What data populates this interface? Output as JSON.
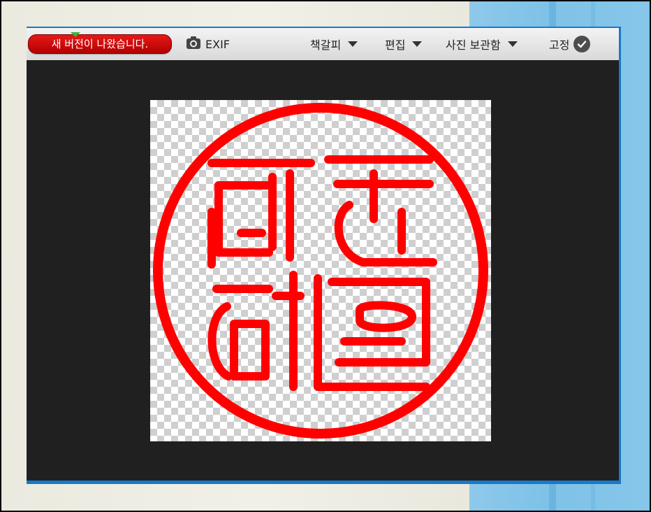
{
  "toolbar": {
    "update_badge": "새 버전이 나왔습니다.",
    "exif_label": "EXIF",
    "menus": [
      {
        "label": "책갈피"
      },
      {
        "label": "편집"
      },
      {
        "label": "사진 보관함"
      }
    ],
    "pin_label": "고정"
  },
  "icons": {
    "camera": "camera-icon",
    "check": "check-circle-icon",
    "caret": "caret-down-icon"
  },
  "image": {
    "seal_color": "#ff0000",
    "background": "transparent-checkerboard"
  },
  "colors": {
    "badge": "#d00000",
    "window_border": "#1a78c8",
    "viewer_bg": "#202020"
  }
}
